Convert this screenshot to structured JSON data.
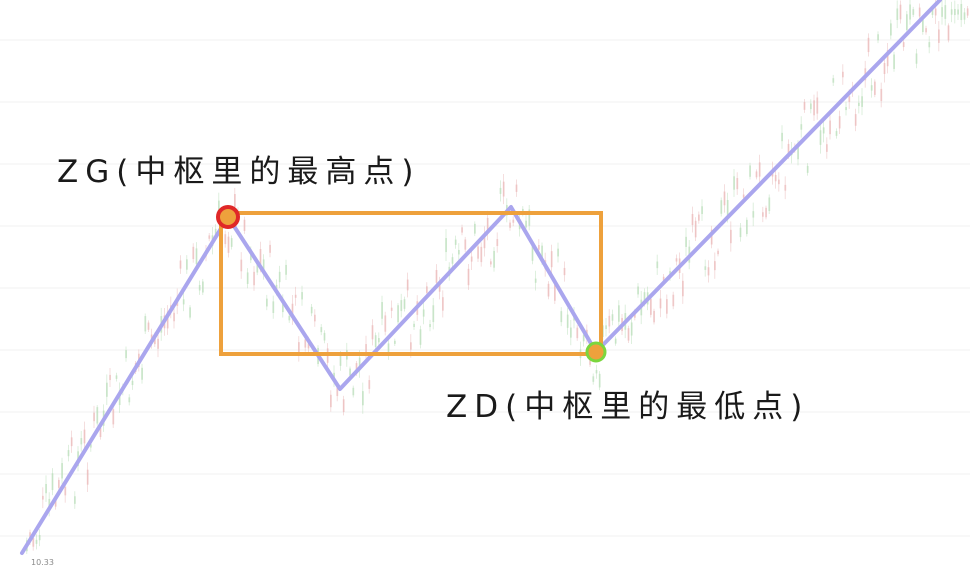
{
  "labels": {
    "zg": "ZG(中枢里的最高点)",
    "zd": "ZD(中枢里的最低点)"
  },
  "axis": {
    "low_tick": "10.33"
  },
  "colors": {
    "background": "#ffffff",
    "stroke": "#aaa6ee",
    "pivot_box": "#eea13c",
    "zg_marker": "#e02828",
    "zd_marker": "#7bd63e",
    "candle_up": "#e9b4b4",
    "candle_down": "#b5dcb5",
    "gridline": "#f0f0f0"
  },
  "icons": {
    "zg_marker": "red-circle",
    "zd_marker": "green-circle"
  }
}
